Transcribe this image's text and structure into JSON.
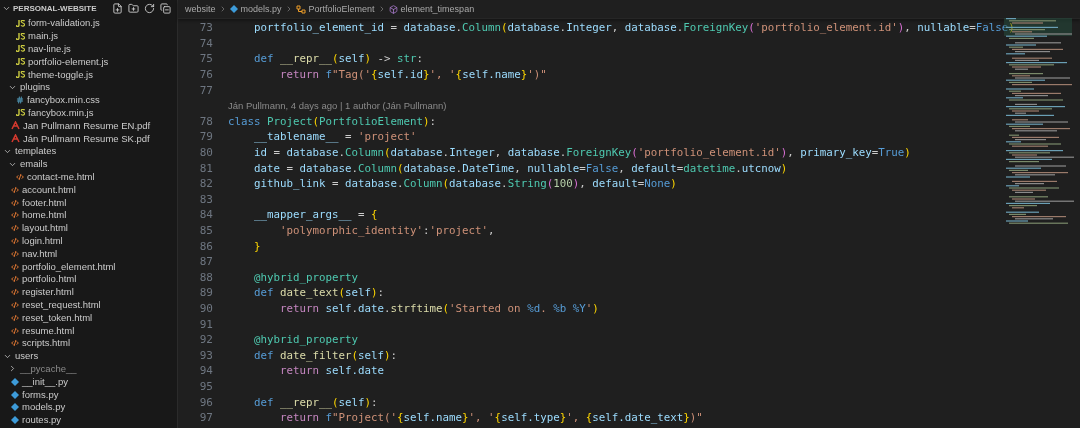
{
  "explorer": {
    "title": "PERSONAL-WEBSITE",
    "tree": [
      {
        "children": [
          {
            "children": [
              {
                "label": "form-validation.js",
                "kind": "js"
              },
              {
                "label": "main.js",
                "kind": "js"
              },
              {
                "label": "nav-line.js",
                "kind": "js"
              },
              {
                "label": "portfolio-element.js",
                "kind": "js"
              },
              {
                "label": "theme-toggle.js",
                "kind": "js"
              }
            ]
          },
          {
            "label": "plugins",
            "kind": "folder",
            "expanded": true,
            "children": [
              {
                "label": "fancybox.min.css",
                "kind": "css"
              },
              {
                "label": "fancybox.min.js",
                "kind": "js"
              }
            ]
          },
          {
            "label": "Jan Pullmann Resume EN.pdf",
            "kind": "pdf"
          },
          {
            "label": "Ján Pullmann Resume SK.pdf",
            "kind": "pdf"
          }
        ]
      },
      {
        "label": "templates",
        "kind": "folder",
        "expanded": true,
        "children": [
          {
            "label": "emails",
            "kind": "folder",
            "expanded": true,
            "children": [
              {
                "label": "contact-me.html",
                "kind": "html"
              }
            ]
          },
          {
            "label": "account.html",
            "kind": "html"
          },
          {
            "label": "footer.html",
            "kind": "html"
          },
          {
            "label": "home.html",
            "kind": "html"
          },
          {
            "label": "layout.html",
            "kind": "html"
          },
          {
            "label": "login.html",
            "kind": "html"
          },
          {
            "label": "nav.html",
            "kind": "html"
          },
          {
            "label": "portfolio_element.html",
            "kind": "html"
          },
          {
            "label": "portfolio.html",
            "kind": "html"
          },
          {
            "label": "register.html",
            "kind": "html"
          },
          {
            "label": "reset_request.html",
            "kind": "html"
          },
          {
            "label": "reset_token.html",
            "kind": "html"
          },
          {
            "label": "resume.html",
            "kind": "html"
          },
          {
            "label": "scripts.html",
            "kind": "html"
          }
        ]
      },
      {
        "label": "users",
        "kind": "folder",
        "expanded": true,
        "children": [
          {
            "label": "__pycache__",
            "kind": "folder",
            "expanded": false
          },
          {
            "label": "__init__.py",
            "kind": "py"
          },
          {
            "label": "forms.py",
            "kind": "py"
          },
          {
            "label": "models.py",
            "kind": "py"
          },
          {
            "label": "routes.py",
            "kind": "py"
          }
        ]
      }
    ]
  },
  "breadcrumb": [
    {
      "label": "website",
      "kind": "folder"
    },
    {
      "label": "models.py",
      "kind": "py"
    },
    {
      "label": "PortfolioElement",
      "kind": "class"
    },
    {
      "label": "element_timespan",
      "kind": "method"
    }
  ],
  "editor": {
    "lines": [
      {
        "kind": "code",
        "number": "73",
        "tokens": [
          {
            "kind": "var",
            "text": "    portfolio_element_id"
          },
          {
            "kind": "plain",
            "text": " = "
          },
          {
            "kind": "var",
            "text": "database"
          },
          {
            "kind": "plain",
            "text": "."
          },
          {
            "kind": "cls",
            "text": "Column"
          },
          {
            "kind": "br1",
            "text": "("
          },
          {
            "kind": "var",
            "text": "database"
          },
          {
            "kind": "plain",
            "text": "."
          },
          {
            "kind": "var",
            "text": "Integer"
          },
          {
            "kind": "plain",
            "text": ", "
          },
          {
            "kind": "var",
            "text": "database"
          },
          {
            "kind": "plain",
            "text": "."
          },
          {
            "kind": "cls",
            "text": "ForeignKey"
          },
          {
            "kind": "br2",
            "text": "("
          },
          {
            "kind": "str",
            "text": "'portfolio_element.id'"
          },
          {
            "kind": "br2",
            "text": ")"
          },
          {
            "kind": "plain",
            "text": ", "
          },
          {
            "kind": "var",
            "text": "nullable"
          },
          {
            "kind": "plain",
            "text": "="
          },
          {
            "kind": "kw",
            "text": "False"
          },
          {
            "kind": "br1",
            "text": ")"
          }
        ]
      },
      {
        "kind": "code",
        "number": "74"
      },
      {
        "kind": "code",
        "number": "75",
        "tokens": [
          {
            "kind": "kw",
            "text": "    def "
          },
          {
            "kind": "fn",
            "text": "__repr__"
          },
          {
            "kind": "br1",
            "text": "("
          },
          {
            "kind": "var",
            "text": "self"
          },
          {
            "kind": "br1",
            "text": ")"
          },
          {
            "kind": "plain",
            "text": " -> "
          },
          {
            "kind": "cls",
            "text": "str"
          },
          {
            "kind": "plain",
            "text": ":"
          }
        ]
      },
      {
        "kind": "code",
        "number": "76",
        "tokens": [
          {
            "kind": "ctl",
            "text": "        return "
          },
          {
            "kind": "kw",
            "text": "f"
          },
          {
            "kind": "str",
            "text": "\"Tag('"
          },
          {
            "kind": "br1",
            "text": "{"
          },
          {
            "kind": "var",
            "text": "self.id"
          },
          {
            "kind": "br1",
            "text": "}"
          },
          {
            "kind": "str",
            "text": "', '"
          },
          {
            "kind": "br1",
            "text": "{"
          },
          {
            "kind": "var",
            "text": "self.name"
          },
          {
            "kind": "br1",
            "text": "}"
          },
          {
            "kind": "str",
            "text": "')\""
          }
        ]
      },
      {
        "kind": "code",
        "number": "77"
      },
      {
        "kind": "blame",
        "text": "Ján Pullmann, 4 days ago | 1 author (Ján Pullmann)"
      },
      {
        "kind": "code",
        "number": "78",
        "tokens": [
          {
            "kind": "kw",
            "text": "class "
          },
          {
            "kind": "cls",
            "text": "Project"
          },
          {
            "kind": "br1",
            "text": "("
          },
          {
            "kind": "cls",
            "text": "PortfolioElement"
          },
          {
            "kind": "br1",
            "text": ")"
          },
          {
            "kind": "plain",
            "text": ":"
          }
        ]
      },
      {
        "kind": "code",
        "number": "79",
        "tokens": [
          {
            "kind": "var",
            "text": "    __tablename__"
          },
          {
            "kind": "plain",
            "text": " = "
          },
          {
            "kind": "str",
            "text": "'project'"
          }
        ]
      },
      {
        "kind": "code",
        "number": "80",
        "tokens": [
          {
            "kind": "var",
            "text": "    id"
          },
          {
            "kind": "plain",
            "text": " = "
          },
          {
            "kind": "var",
            "text": "database"
          },
          {
            "kind": "plain",
            "text": "."
          },
          {
            "kind": "cls",
            "text": "Column"
          },
          {
            "kind": "br1",
            "text": "("
          },
          {
            "kind": "var",
            "text": "database"
          },
          {
            "kind": "plain",
            "text": "."
          },
          {
            "kind": "var",
            "text": "Integer"
          },
          {
            "kind": "plain",
            "text": ", "
          },
          {
            "kind": "var",
            "text": "database"
          },
          {
            "kind": "plain",
            "text": "."
          },
          {
            "kind": "cls",
            "text": "ForeignKey"
          },
          {
            "kind": "br2",
            "text": "("
          },
          {
            "kind": "str",
            "text": "'portfolio_element.id'"
          },
          {
            "kind": "br2",
            "text": ")"
          },
          {
            "kind": "plain",
            "text": ", "
          },
          {
            "kind": "var",
            "text": "primary_key"
          },
          {
            "kind": "plain",
            "text": "="
          },
          {
            "kind": "kw",
            "text": "True"
          },
          {
            "kind": "br1",
            "text": ")"
          }
        ]
      },
      {
        "kind": "code",
        "number": "81",
        "tokens": [
          {
            "kind": "var",
            "text": "    date"
          },
          {
            "kind": "plain",
            "text": " = "
          },
          {
            "kind": "var",
            "text": "database"
          },
          {
            "kind": "plain",
            "text": "."
          },
          {
            "kind": "cls",
            "text": "Column"
          },
          {
            "kind": "br1",
            "text": "("
          },
          {
            "kind": "var",
            "text": "database"
          },
          {
            "kind": "plain",
            "text": "."
          },
          {
            "kind": "var",
            "text": "DateTime"
          },
          {
            "kind": "plain",
            "text": ", "
          },
          {
            "kind": "var",
            "text": "nullable"
          },
          {
            "kind": "plain",
            "text": "="
          },
          {
            "kind": "kw",
            "text": "False"
          },
          {
            "kind": "plain",
            "text": ", "
          },
          {
            "kind": "var",
            "text": "default"
          },
          {
            "kind": "plain",
            "text": "="
          },
          {
            "kind": "cls",
            "text": "datetime"
          },
          {
            "kind": "plain",
            "text": "."
          },
          {
            "kind": "var",
            "text": "utcnow"
          },
          {
            "kind": "br1",
            "text": ")"
          }
        ]
      },
      {
        "kind": "code",
        "number": "82",
        "tokens": [
          {
            "kind": "var",
            "text": "    github_link"
          },
          {
            "kind": "plain",
            "text": " = "
          },
          {
            "kind": "var",
            "text": "database"
          },
          {
            "kind": "plain",
            "text": "."
          },
          {
            "kind": "cls",
            "text": "Column"
          },
          {
            "kind": "br1",
            "text": "("
          },
          {
            "kind": "var",
            "text": "database"
          },
          {
            "kind": "plain",
            "text": "."
          },
          {
            "kind": "cls",
            "text": "String"
          },
          {
            "kind": "br2",
            "text": "("
          },
          {
            "kind": "num",
            "text": "100"
          },
          {
            "kind": "br2",
            "text": ")"
          },
          {
            "kind": "plain",
            "text": ", "
          },
          {
            "kind": "var",
            "text": "default"
          },
          {
            "kind": "plain",
            "text": "="
          },
          {
            "kind": "kw",
            "text": "None"
          },
          {
            "kind": "br1",
            "text": ")"
          }
        ]
      },
      {
        "kind": "code",
        "number": "83"
      },
      {
        "kind": "code",
        "number": "84",
        "tokens": [
          {
            "kind": "var",
            "text": "    __mapper_args__"
          },
          {
            "kind": "plain",
            "text": " = "
          },
          {
            "kind": "br1",
            "text": "{"
          }
        ]
      },
      {
        "kind": "code",
        "number": "85",
        "tokens": [
          {
            "kind": "str",
            "text": "        'polymorphic_identity'"
          },
          {
            "kind": "plain",
            "text": ":"
          },
          {
            "kind": "str",
            "text": "'project'"
          },
          {
            "kind": "plain",
            "text": ","
          }
        ]
      },
      {
        "kind": "code",
        "number": "86",
        "tokens": [
          {
            "kind": "br1",
            "text": "    }"
          }
        ]
      },
      {
        "kind": "code",
        "number": "87"
      },
      {
        "kind": "code",
        "number": "88",
        "tokens": [
          {
            "kind": "dec",
            "text": "    @hybrid_property"
          }
        ]
      },
      {
        "kind": "code",
        "number": "89",
        "tokens": [
          {
            "kind": "kw",
            "text": "    def "
          },
          {
            "kind": "fn",
            "text": "date_text"
          },
          {
            "kind": "br1",
            "text": "("
          },
          {
            "kind": "var",
            "text": "self"
          },
          {
            "kind": "br1",
            "text": ")"
          },
          {
            "kind": "plain",
            "text": ":"
          }
        ]
      },
      {
        "kind": "code",
        "number": "90",
        "tokens": [
          {
            "kind": "ctl",
            "text": "        return "
          },
          {
            "kind": "var",
            "text": "self"
          },
          {
            "kind": "plain",
            "text": "."
          },
          {
            "kind": "var",
            "text": "date"
          },
          {
            "kind": "plain",
            "text": "."
          },
          {
            "kind": "fn",
            "text": "strftime"
          },
          {
            "kind": "br1",
            "text": "("
          },
          {
            "kind": "str",
            "text": "'Started on "
          },
          {
            "kind": "kw",
            "text": "%d"
          },
          {
            "kind": "str",
            "text": ". "
          },
          {
            "kind": "kw",
            "text": "%b"
          },
          {
            "kind": "kw",
            "text": " %Y"
          },
          {
            "kind": "str",
            "text": "'"
          },
          {
            "kind": "br1",
            "text": ")"
          }
        ]
      },
      {
        "kind": "code",
        "number": "91"
      },
      {
        "kind": "code",
        "number": "92",
        "tokens": [
          {
            "kind": "dec",
            "text": "    @hybrid_property"
          }
        ]
      },
      {
        "kind": "code",
        "number": "93",
        "tokens": [
          {
            "kind": "kw",
            "text": "    def "
          },
          {
            "kind": "fn",
            "text": "date_filter"
          },
          {
            "kind": "br1",
            "text": "("
          },
          {
            "kind": "var",
            "text": "self"
          },
          {
            "kind": "br1",
            "text": ")"
          },
          {
            "kind": "plain",
            "text": ":"
          }
        ]
      },
      {
        "kind": "code",
        "number": "94",
        "tokens": [
          {
            "kind": "ctl",
            "text": "        return "
          },
          {
            "kind": "var",
            "text": "self.date"
          }
        ]
      },
      {
        "kind": "code",
        "number": "95"
      },
      {
        "kind": "code",
        "number": "96",
        "tokens": [
          {
            "kind": "kw",
            "text": "    def "
          },
          {
            "kind": "fn",
            "text": "__repr__"
          },
          {
            "kind": "br1",
            "text": "("
          },
          {
            "kind": "var",
            "text": "self"
          },
          {
            "kind": "br1",
            "text": ")"
          },
          {
            "kind": "plain",
            "text": ":"
          }
        ]
      },
      {
        "kind": "code",
        "number": "97",
        "tokens": [
          {
            "kind": "ctl",
            "text": "        return "
          },
          {
            "kind": "kw",
            "text": "f"
          },
          {
            "kind": "str",
            "text": "\"Project('"
          },
          {
            "kind": "br1",
            "text": "{"
          },
          {
            "kind": "var",
            "text": "self.name"
          },
          {
            "kind": "br1",
            "text": "}"
          },
          {
            "kind": "str",
            "text": "', '"
          },
          {
            "kind": "br1",
            "text": "{"
          },
          {
            "kind": "var",
            "text": "self.type"
          },
          {
            "kind": "br1",
            "text": "}"
          },
          {
            "kind": "str",
            "text": "', "
          },
          {
            "kind": "br1",
            "text": "{"
          },
          {
            "kind": "var",
            "text": "self.date_text"
          },
          {
            "kind": "br1",
            "text": "}"
          },
          {
            "kind": "str",
            "text": ")\""
          }
        ]
      }
    ]
  }
}
